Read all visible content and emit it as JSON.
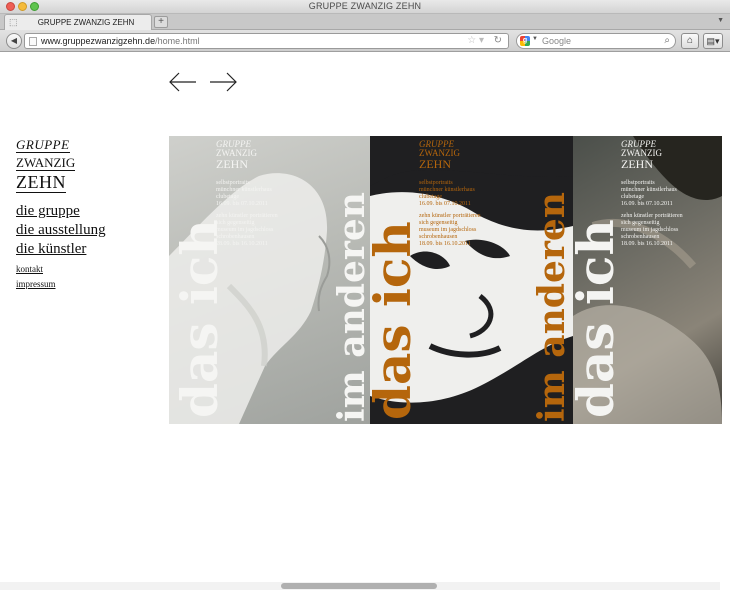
{
  "window": {
    "title": "GRUPPE ZWANZIG ZEHN"
  },
  "tabs": [
    {
      "label": "GRUPPE ZWANZIG ZEHN"
    }
  ],
  "toolbar": {
    "url_domain": "www.gruppezwanzigzehn.de",
    "url_path": "/home.html",
    "search_placeholder": "Google"
  },
  "page": {
    "logo": {
      "line1": "GRUPPE",
      "line2": "ZWANZIG",
      "line3": "ZEHN"
    },
    "nav": {
      "primary": [
        {
          "label": "die gruppe"
        },
        {
          "label": "die ausstellung"
        },
        {
          "label": "die künstler"
        }
      ],
      "secondary": [
        {
          "label": "kontakt"
        },
        {
          "label": "impressum"
        }
      ]
    },
    "posters": [
      {
        "vertical_title": "das ich",
        "vertical_subtitle": "im anderen",
        "head": {
          "line1": "GRUPPE",
          "line2": "ZWANZIG",
          "line3": "ZEHN"
        },
        "block1": [
          "selbstportraits",
          "münchner künstlerhaus",
          "clubetage",
          "16.09. bis 07.10.2011"
        ],
        "block2": [
          "zehn künstler porträtieren",
          "sich gegenseitig",
          "museum im jagdschloss",
          "schrobenhausen",
          "28.09. bis 16.10.2011"
        ]
      },
      {
        "vertical_title": "das ich",
        "vertical_subtitle": "im anderen",
        "head": {
          "line1": "GRUPPE",
          "line2": "ZWANZIG",
          "line3": "ZEHN"
        },
        "block1": [
          "selbstportraits",
          "münchner künstlerhaus",
          "clubetage",
          "16.09. bis 07.10.2011"
        ],
        "block2": [
          "zehn künstler porträtieren",
          "sich gegenseitig",
          "museum im jagdschloss",
          "schrobenhausen",
          "18.09. bis 16.10.2011"
        ]
      },
      {
        "vertical_title": "das ich",
        "head": {
          "line1": "GRUPPE",
          "line2": "ZWANZIG",
          "line3": "ZEHN"
        },
        "block1": [
          "selbstportraits",
          "münchner künstlerhaus",
          "clubetage",
          "16.09. bis 07.10.2011"
        ],
        "block2": [
          "zehn künstler porträtieren",
          "sich gegenseitig",
          "museum im jagdschloss",
          "schrobenhausen",
          "18.09. bis 16.10.2011"
        ]
      }
    ]
  },
  "colors": {
    "poster_text_light": "#f4f4f2",
    "poster_accent_orange": "#b5660c",
    "poster_dark": "#1f1f21",
    "link": "#111111"
  },
  "icons": {
    "prev": "arrow-left-icon",
    "next": "arrow-right-icon",
    "back": "back-icon",
    "home": "home-icon",
    "bookmark": "star-icon",
    "reload": "reload-icon",
    "search": "magnifier-icon"
  }
}
